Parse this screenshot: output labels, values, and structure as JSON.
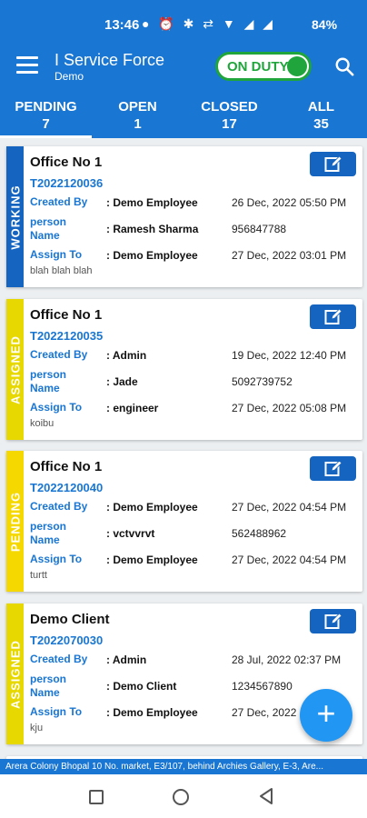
{
  "status_bar": {
    "time": "13:46",
    "icons": "● ⏰ ✱ ⇄ ▼ ◢ ◢",
    "battery": "84%"
  },
  "app_bar": {
    "title": "I Service Force",
    "subtitle": "Demo",
    "duty_label": "ON DUTY",
    "duty_on": true
  },
  "tabs": [
    {
      "label": "PENDING",
      "count": "7",
      "active": true
    },
    {
      "label": "OPEN",
      "count": "1",
      "active": false
    },
    {
      "label": "CLOSED",
      "count": "17",
      "active": false
    },
    {
      "label": "ALL",
      "count": "35",
      "active": false
    }
  ],
  "field_labels": {
    "created_by": "Created By",
    "person_name": "person\nName",
    "assign_to": "Assign To"
  },
  "tickets": [
    {
      "status": "WORKING",
      "status_color": "#1565c0",
      "title": "Office No 1",
      "id": "T2022120036",
      "created_by": ": Demo Employee",
      "created_date": "26 Dec, 2022 05:50 PM",
      "person_name": ": Ramesh Sharma",
      "phone": "956847788",
      "assign_to": ": Demo Employee",
      "assign_date": "27 Dec, 2022 03:01 PM",
      "note": "blah blah blah"
    },
    {
      "status": "ASSIGNED",
      "status_color": "#e6d800",
      "title": "Office No 1",
      "id": "T2022120035",
      "created_by": ": Admin",
      "created_date": "19 Dec, 2022 12:40 PM",
      "person_name": ": Jade",
      "phone": "5092739752",
      "assign_to": ": engineer",
      "assign_date": "27 Dec, 2022 05:08 PM",
      "note": "koibu"
    },
    {
      "status": "PENDING",
      "status_color": "#f5d800",
      "title": "Office No 1",
      "id": "T2022120040",
      "created_by": ": Demo Employee",
      "created_date": "27 Dec, 2022 04:54 PM",
      "person_name": ": vctvvrvt",
      "phone": "562488962",
      "assign_to": ": Demo Employee",
      "assign_date": "27 Dec, 2022 04:54 PM",
      "note": "turtt"
    },
    {
      "status": "ASSIGNED",
      "status_color": "#e6d800",
      "title": "Demo Client",
      "id": "T2022070030",
      "created_by": ": Admin",
      "created_date": "28 Jul, 2022 02:37 PM",
      "person_name": ": Demo Client",
      "phone": "1234567890",
      "assign_to": ": Demo Employee",
      "assign_date": "27 Dec, 2022",
      "note": "kju"
    }
  ],
  "fab": {
    "label": "+"
  },
  "location": "Arera Colony Bhopal 10 No. market, E3/107, behind Archies Gallery, E-3, Are..."
}
